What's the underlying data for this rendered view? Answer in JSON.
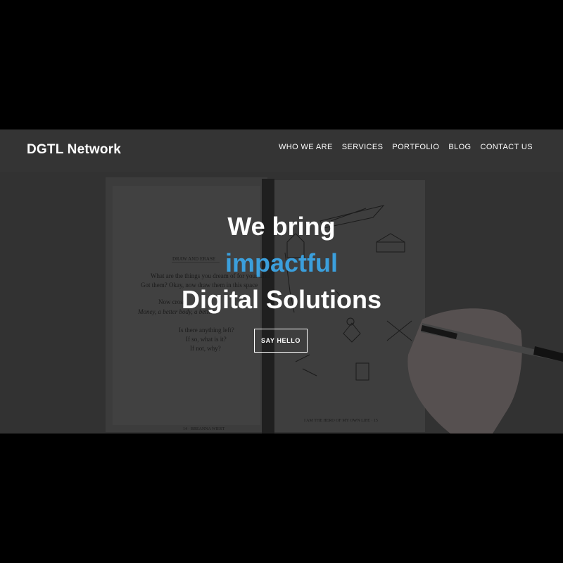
{
  "brand": "DGTL Network",
  "nav": {
    "who_we_are": "WHO WE ARE",
    "services": "SERVICES",
    "portfolio": "PORTFOLIO",
    "blog": "BLOG",
    "contact_us": "CONTACT US"
  },
  "hero": {
    "line1": "We bring",
    "line2": "impactful",
    "line3": "Digital Solutions",
    "cta": "SAY HELLO"
  },
  "background_image": {
    "book_left_page": {
      "heading": "DRAW AND ERASE",
      "lines": [
        "What are the things you dream of for your life?",
        "Got them? Okay, now draw them in this space",
        "Now cross",
        "Money, a better body, a better",
        "Is there anything left?",
        "If so, what is it?",
        "If not, why?"
      ],
      "footer": "14 · BREANNA WIEST"
    },
    "book_right_page": {
      "footer": "I AM THE HERO OF MY OWN LIFE · 15"
    }
  },
  "colors": {
    "accent": "#3b9fdc",
    "text": "#ffffff",
    "page_bg": "#000000"
  }
}
